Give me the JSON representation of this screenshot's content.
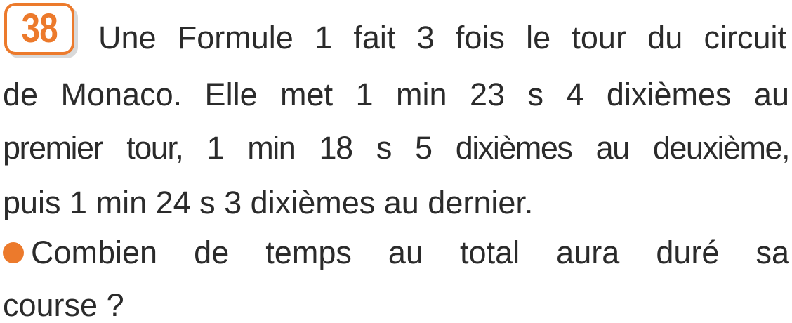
{
  "exercise": {
    "number": "38",
    "statement_lines": [
      "Une Formule 1 fait 3 fois le tour du circuit",
      "de Monaco. Elle met 1 min 23 s 4 dixièmes au",
      "premier tour, 1 min 18 s 5 dixièmes au deuxième,",
      "puis 1 min 24 s 3 dixièmes au dernier."
    ],
    "question_lines": [
      "Combien de temps au total aura duré sa",
      "course ?"
    ],
    "accent_color": "#ec7a2c"
  }
}
